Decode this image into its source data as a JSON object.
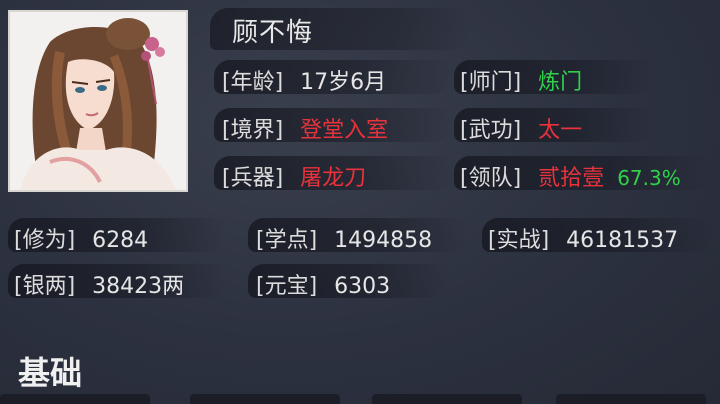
{
  "character": {
    "name": "顾不悔",
    "age_label": "[年龄]",
    "age_value": "17岁6月",
    "sect_label": "[师门]",
    "sect_value": "炼门",
    "realm_label": "[境界]",
    "realm_value": "登堂入室",
    "martial_label": "[武功]",
    "martial_value": "太一",
    "weapon_label": "[兵器]",
    "weapon_value": "屠龙刀",
    "lead_label": "[领队]",
    "lead_value": "贰拾壹",
    "lead_percent": "67.3%"
  },
  "stats": {
    "cultivation_label": "[修为]",
    "cultivation_value": "6284",
    "study_label": "[学点]",
    "study_value": "1494858",
    "combat_label": "[实战]",
    "combat_value": "46181537",
    "silver_label": "[银两]",
    "silver_value": "38423两",
    "ingot_label": "[元宝]",
    "ingot_value": "6303"
  },
  "section": {
    "title": "基础"
  },
  "colors": {
    "green": "#2fd14a",
    "red": "#e8323c",
    "background": "#2c3140"
  }
}
